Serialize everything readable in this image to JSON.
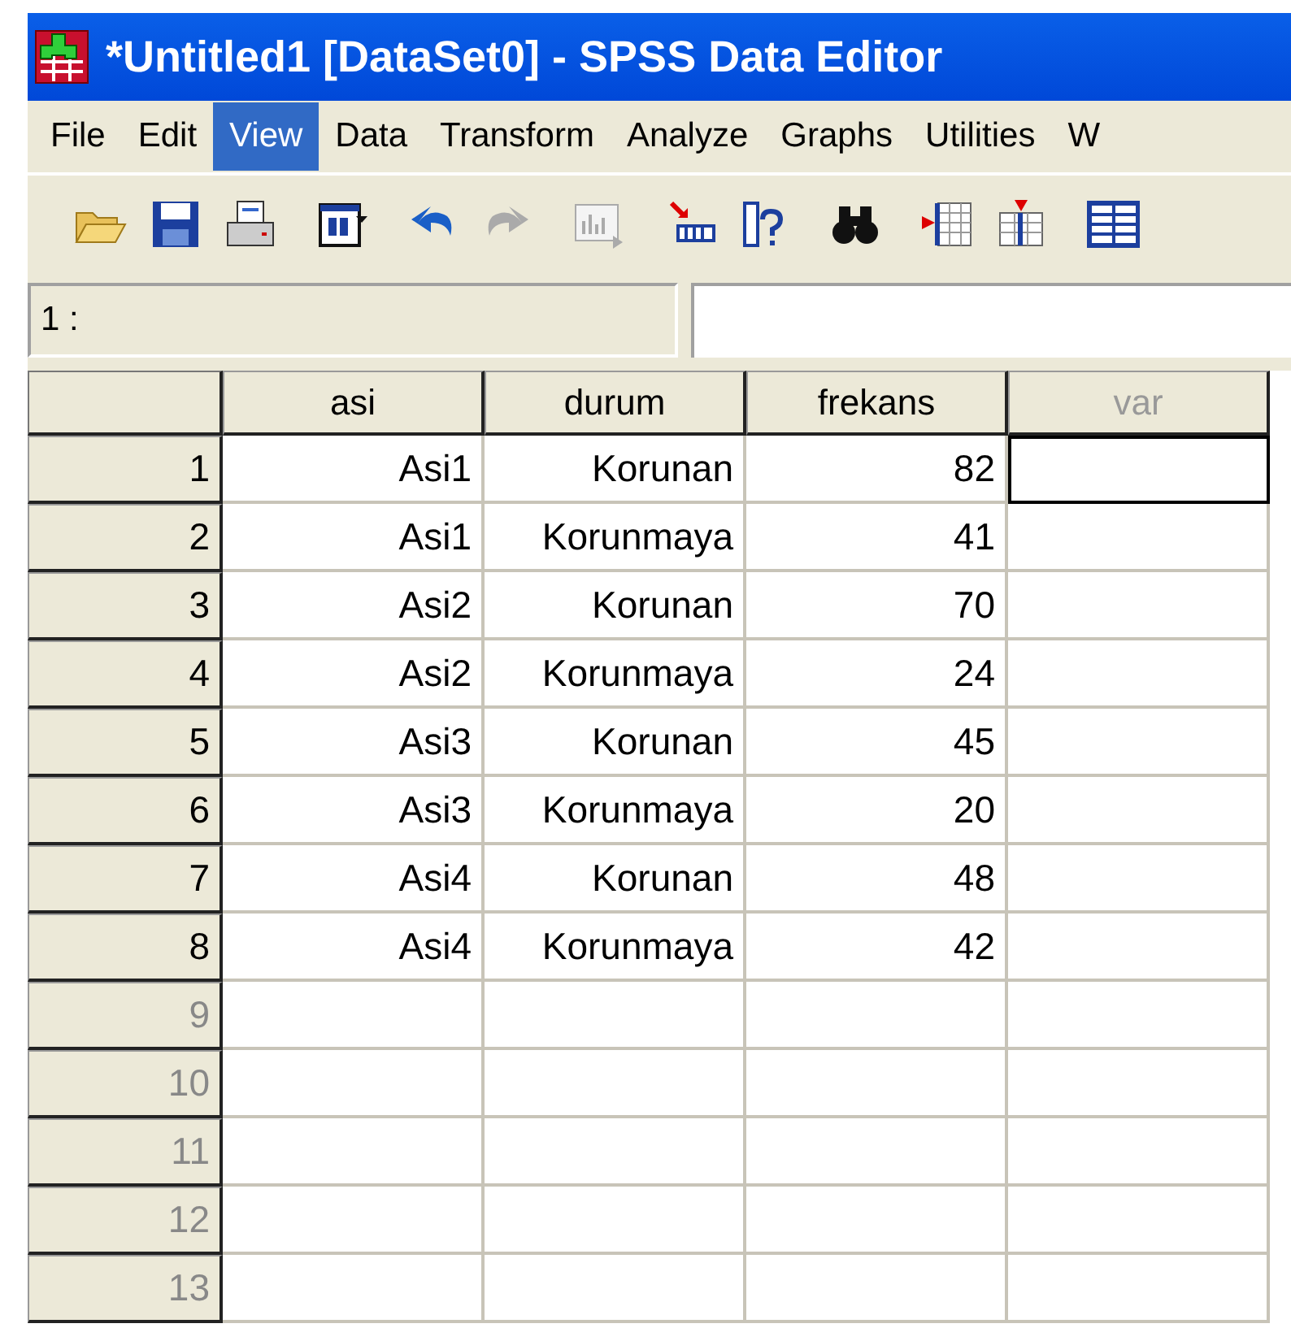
{
  "window": {
    "title": "*Untitled1 [DataSet0] - SPSS Data Editor"
  },
  "menu": [
    {
      "label": "File",
      "selected": false
    },
    {
      "label": "Edit",
      "selected": false
    },
    {
      "label": "View",
      "selected": true
    },
    {
      "label": "Data",
      "selected": false
    },
    {
      "label": "Transform",
      "selected": false
    },
    {
      "label": "Analyze",
      "selected": false
    },
    {
      "label": "Graphs",
      "selected": false
    },
    {
      "label": "Utilities",
      "selected": false
    },
    {
      "label": "W",
      "selected": false
    }
  ],
  "cell_ref": {
    "label": "1 :"
  },
  "table": {
    "columns": [
      {
        "label": "asi",
        "disabled": false
      },
      {
        "label": "durum",
        "disabled": false
      },
      {
        "label": "frekans",
        "disabled": false
      },
      {
        "label": "var",
        "disabled": true
      }
    ],
    "rows": [
      {
        "number": "1",
        "cells": [
          "Asi1",
          "Korunan",
          "82"
        ],
        "var_cell_selected": true
      },
      {
        "number": "2",
        "cells": [
          "Asi1",
          "Korunmaya",
          "41"
        ],
        "var_cell_selected": false
      },
      {
        "number": "3",
        "cells": [
          "Asi2",
          "Korunan",
          "70"
        ],
        "var_cell_selected": false
      },
      {
        "number": "4",
        "cells": [
          "Asi2",
          "Korunmaya",
          "24"
        ],
        "var_cell_selected": false
      },
      {
        "number": "5",
        "cells": [
          "Asi3",
          "Korunan",
          "45"
        ],
        "var_cell_selected": false
      },
      {
        "number": "6",
        "cells": [
          "Asi3",
          "Korunmaya",
          "20"
        ],
        "var_cell_selected": false
      },
      {
        "number": "7",
        "cells": [
          "Asi4",
          "Korunan",
          "48"
        ],
        "var_cell_selected": false
      },
      {
        "number": "8",
        "cells": [
          "Asi4",
          "Korunmaya",
          "42"
        ],
        "var_cell_selected": false
      },
      {
        "number": "9",
        "cells": [],
        "var_cell_selected": false
      },
      {
        "number": "10",
        "cells": [],
        "var_cell_selected": false
      },
      {
        "number": "11",
        "cells": [],
        "var_cell_selected": false
      },
      {
        "number": "12",
        "cells": [],
        "var_cell_selected": false
      },
      {
        "number": "13",
        "cells": [],
        "var_cell_selected": false
      }
    ]
  }
}
